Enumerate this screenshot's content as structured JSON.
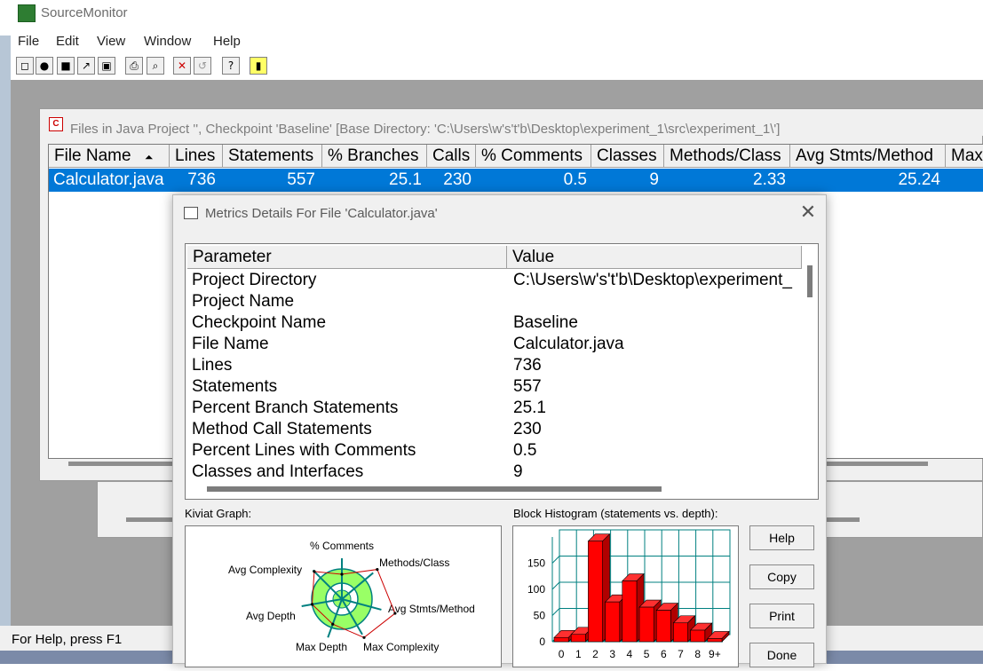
{
  "app": {
    "title": "SourceMonitor"
  },
  "menu": [
    "File",
    "Edit",
    "View",
    "Window",
    "Help"
  ],
  "toolbar": {
    "icons": [
      "new-icon",
      "record-icon",
      "checkpoint-icon",
      "open-icon",
      "save-icon",
      "print-icon",
      "preview-icon",
      "delete-icon",
      "undo-icon",
      "help-icon",
      "pin-icon"
    ],
    "glyphs": [
      "◻",
      "●",
      "■",
      "↗",
      "▣",
      "⎙",
      "⌕",
      "✕",
      "↺",
      "?",
      "▮"
    ]
  },
  "child": {
    "title": "Files in Java Project '', Checkpoint 'Baseline'  [Base Directory: 'C:\\Users\\w's't'b\\Desktop\\experiment_1\\src\\experiment_1\\']",
    "columns": [
      "File Name",
      "Lines",
      "Statements",
      "% Branches",
      "Calls",
      "% Comments",
      "Classes",
      "Methods/Class",
      "Avg Stmts/Method",
      "Max"
    ],
    "sort_indicator": "⏶",
    "row": [
      "Calculator.java",
      "736",
      "557",
      "25.1",
      "230",
      "0.5",
      "9",
      "2.33",
      "25.24",
      ""
    ]
  },
  "status": {
    "text": "For Help, press F1"
  },
  "dialog": {
    "title": "Metrics Details For File 'Calculator.java'",
    "close_glyph": "✕",
    "columns": [
      "Parameter",
      "Value"
    ],
    "rows": [
      [
        "Project Directory",
        "C:\\Users\\w's't'b\\Desktop\\experiment_"
      ],
      [
        "Project Name",
        ""
      ],
      [
        "Checkpoint Name",
        "Baseline"
      ],
      [
        "File Name",
        "Calculator.java"
      ],
      [
        "Lines",
        "736"
      ],
      [
        "Statements",
        "557"
      ],
      [
        "Percent Branch Statements",
        "25.1"
      ],
      [
        "Method Call Statements",
        "230"
      ],
      [
        "Percent Lines with Comments",
        "0.5"
      ],
      [
        "Classes and Interfaces",
        "9"
      ]
    ],
    "kiviat_label": "Kiviat Graph:",
    "histogram_label": "Block Histogram (statements vs. depth):",
    "buttons": [
      "Help",
      "Copy",
      "Print",
      "Done"
    ]
  },
  "kiviat": {
    "axes": [
      "% Comments",
      "Methods/Class",
      "Avg Stmts/Method",
      "Max Complexity",
      "Max Depth",
      "Avg Depth",
      "Avg Complexity"
    ]
  },
  "histogram": {
    "type": "bar",
    "categories": [
      "0",
      "1",
      "2",
      "3",
      "4",
      "5",
      "6",
      "7",
      "8",
      "9+"
    ],
    "values": [
      8,
      14,
      192,
      76,
      116,
      66,
      60,
      36,
      22,
      6
    ],
    "yticks": [
      "0",
      "50",
      "100",
      "150"
    ],
    "ylim": [
      0,
      200
    ],
    "bar_color": "#ff0000",
    "grid_color": "#008080"
  }
}
